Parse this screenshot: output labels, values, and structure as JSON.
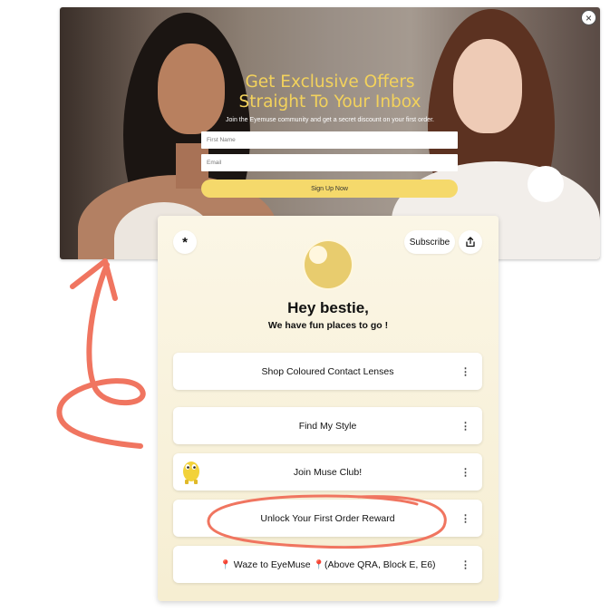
{
  "popup": {
    "title_line1": "Get Exclusive Offers",
    "title_line2": "Straight To Your Inbox",
    "subtitle": "Join the Eyemuse community and get a secret discount on your first order.",
    "first_name_placeholder": "First Name",
    "email_placeholder": "Email",
    "signup_label": "Sign Up Now",
    "close_glyph": "×"
  },
  "card": {
    "subscribe_label": "Subscribe",
    "logo_glyph": "*",
    "greeting": "Hey bestie,",
    "tagline": "We have fun places to go !",
    "links": [
      {
        "label": "Shop Coloured Contact Lenses"
      },
      {
        "label": "Find My Style"
      },
      {
        "label": "Join Muse Club!"
      },
      {
        "label": "Unlock Your First Order Reward"
      },
      {
        "label_prefix": "📍",
        "label": " Waze to EyeMuse ",
        "label_pin": "📍",
        "label_suffix": "(Above QRA, Block E, E6)"
      }
    ],
    "kebab_glyph": "⋮"
  },
  "colors": {
    "popup_title": "#f3d25c",
    "signup_button": "#f5d96b",
    "card_bg": "#f8f1da",
    "annotation": "#f07560",
    "avatar_moon": "#e8cc6e"
  },
  "icons": {
    "close": "close-icon",
    "logo": "asterisk-icon",
    "share": "share-icon",
    "avatar": "moon-avatar-icon",
    "menu": "kebab-menu-icon",
    "pin": "location-pin-icon",
    "mascot": "yellow-mascot-icon"
  }
}
